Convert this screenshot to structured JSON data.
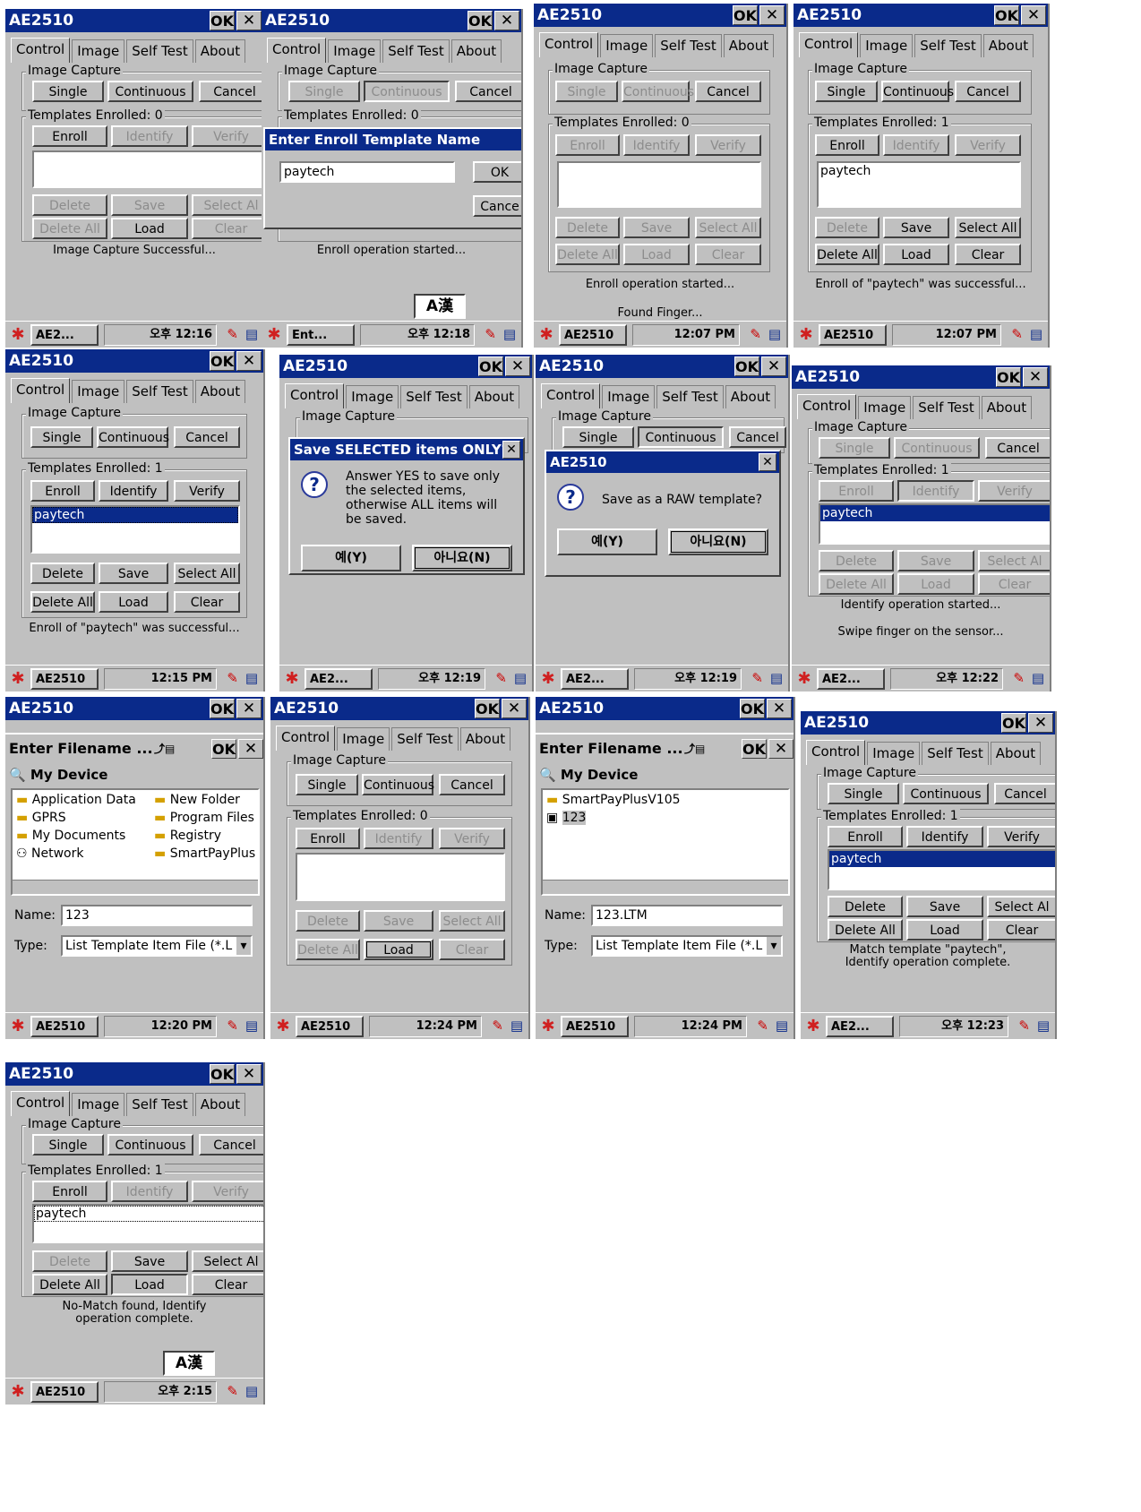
{
  "app_title": "AE2510",
  "ok": "OK",
  "close": "✕",
  "tabs": [
    "Control",
    "Image",
    "Self Test",
    "About"
  ],
  "group_capture": "Image Capture",
  "btn_single": "Single",
  "btn_continuous": "Continuous",
  "btn_cancel": "Cancel",
  "btn_enroll": "Enroll",
  "btn_identify": "Identify",
  "btn_verify": "Verify",
  "btn_delete": "Delete",
  "btn_save": "Save",
  "btn_select_all": "Select All",
  "btn_select_all_cut": "Select Al",
  "btn_delete_all": "Delete All",
  "btn_load": "Load",
  "btn_clear": "Clear",
  "templates_0": "Templates Enrolled: 0",
  "templates_1": "Templates Enrolled: 1",
  "item_paytech": "paytech",
  "screens": {
    "s1": {
      "status": "Image Capture Successful...",
      "taskbar_app": "AE2...",
      "tray": "오후 12:16"
    },
    "s2": {
      "dialog_title": "Enter Enroll Template Name",
      "input": "paytech",
      "dlg_ok": "OK",
      "dlg_cancel": "Cance",
      "status": "Enroll operation started...",
      "ime": "A漢",
      "taskbar_app": "Ent...",
      "tray": "오후 12:18"
    },
    "s3": {
      "status1": "Enroll operation started...",
      "status2": "Found Finger...",
      "taskbar_app": "AE2510",
      "tray": "12:07 PM"
    },
    "s4": {
      "status": "Enroll of \"paytech\" was successful...",
      "taskbar_app": "AE2510",
      "tray": "12:07 PM"
    },
    "s5": {
      "status": "Enroll of \"paytech\" was successful...",
      "taskbar_app": "AE2510",
      "tray": "12:15 PM"
    },
    "s6": {
      "dialog_title": "Save SELECTED items ONLY?",
      "text": "Answer YES to save only the selected items, otherwise ALL items will be saved.",
      "yes": "예(Y)",
      "no": "아니요(N)",
      "taskbar_app": "AE2...",
      "tray": "오후 12:19"
    },
    "s7": {
      "dialog_title": "AE2510",
      "text": "Save as a RAW template?",
      "yes": "예(Y)",
      "no": "아니요(N)",
      "taskbar_app": "AE2...",
      "tray": "오후 12:19"
    },
    "s8": {
      "status1": "Identify operation started...",
      "status2": "Swipe finger on the sensor...",
      "taskbar_app": "AE2...",
      "tray": "오후 12:22"
    },
    "s9": {
      "fd_title": "Enter Filename ...",
      "path": "My Device",
      "items": [
        "Application Data",
        "New Folder",
        "GPRS",
        "Program Files",
        "My Documents",
        "Registry",
        "Network",
        "SmartPayPlus"
      ],
      "name_label": "Name:",
      "name_value": "123",
      "type_label": "Type:",
      "type_value": "List Template Item File (*.L",
      "taskbar_app": "AE2510",
      "tray": "12:20 PM"
    },
    "s10": {
      "taskbar_app": "AE2510",
      "tray": "12:24 PM"
    },
    "s11": {
      "fd_title": "Enter Filename ...",
      "path": "My Device",
      "items": [
        "SmartPayPlusV105",
        "123"
      ],
      "name_label": "Name:",
      "name_value": "123.LTM",
      "type_label": "Type:",
      "type_value": "List Template Item File (*.L",
      "taskbar_app": "AE2510",
      "tray": "12:24 PM"
    },
    "s12": {
      "status": "Match template \"paytech\", Identify operation complete.",
      "taskbar_app": "AE2...",
      "tray": "오후 12:23"
    },
    "s13": {
      "status": "No-Match found, Identify operation complete.",
      "ime": "A漢",
      "taskbar_app": "AE2510",
      "tray": "오후 2:15"
    }
  }
}
